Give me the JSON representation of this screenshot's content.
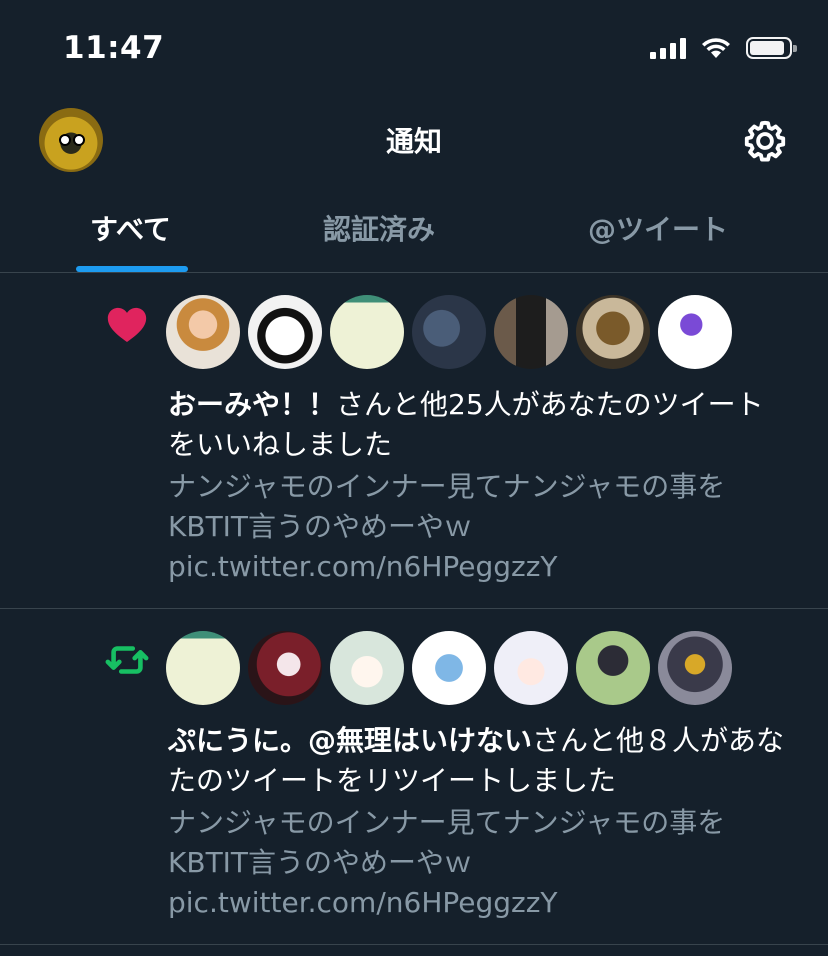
{
  "status_bar": {
    "time": "11:47"
  },
  "header": {
    "title": "通知"
  },
  "tabs": [
    {
      "label": "すべて",
      "active": true
    },
    {
      "label": "認証済み",
      "active": false
    },
    {
      "label": "@ツイート",
      "active": false
    }
  ],
  "notifications": [
    {
      "type": "like",
      "icon": "heart-icon",
      "icon_color": "#e0245e",
      "actor": "おーみや！！",
      "action": "さんと他25人があなたのツイートをいいねしました",
      "tweet_text": "ナンジャモのインナー見てナンジャモの事をKBTIT言うのやめーやｗ pic.twitter.com/n6HPeggzzY"
    },
    {
      "type": "retweet",
      "icon": "retweet-icon",
      "icon_color": "#17bf63",
      "actor": "ぷにうに。@無理はいけない",
      "action": "さんと他８人があなたのツイートをリツイートしました",
      "tweet_text": "ナンジャモのインナー見てナンジャモの事をKBTIT言うのやめーやｗ pic.twitter.com/n6HPeggzzY"
    }
  ],
  "colors": {
    "background": "#15202b",
    "accent": "#1d9bf0",
    "secondary_text": "#8899a6",
    "divider": "#38444d"
  }
}
